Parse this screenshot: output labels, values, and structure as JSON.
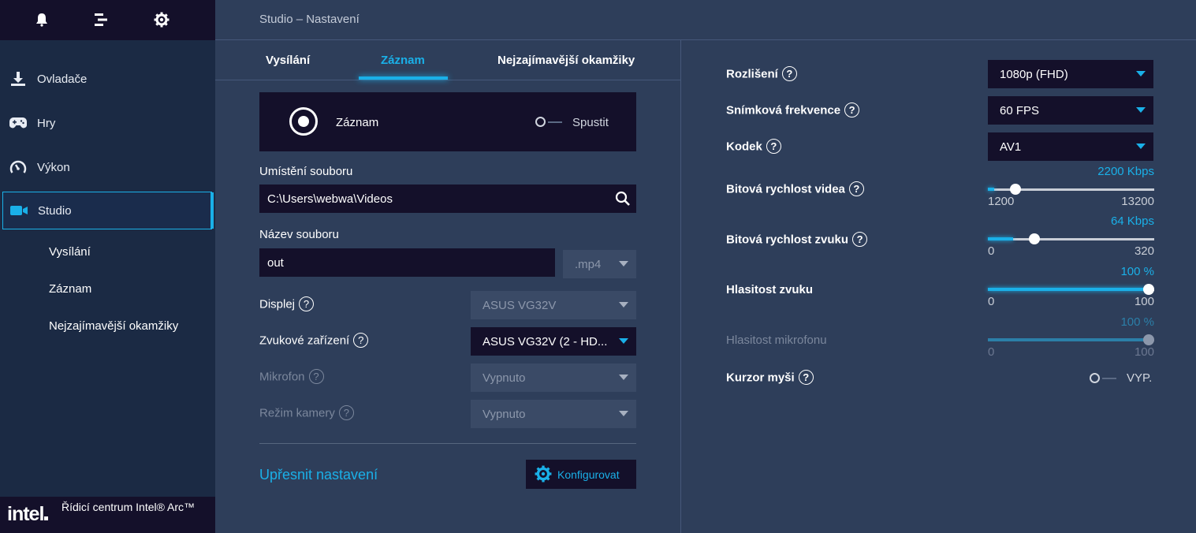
{
  "app": {
    "breadcrumb": "Studio – Nastavení",
    "footer_brand": "intel",
    "footer_title": "Řídicí centrum Intel® Arc™"
  },
  "sidebar": {
    "top_icons": [
      "bell-icon",
      "tasks-icon",
      "gear-icon"
    ],
    "items": [
      {
        "label": "Ovladače",
        "icon": "download-icon"
      },
      {
        "label": "Hry",
        "icon": "gamepad-icon"
      },
      {
        "label": "Výkon",
        "icon": "speedometer-icon"
      },
      {
        "label": "Studio",
        "icon": "camera-icon"
      }
    ],
    "sub_items": [
      "Vysílání",
      "Záznam",
      "Nejzajímavější okamžiky"
    ]
  },
  "tabs": [
    {
      "label": "Vysílání"
    },
    {
      "label": "Záznam"
    },
    {
      "label": "Nejzajímavější okamžiky"
    }
  ],
  "record": {
    "label": "Záznam",
    "toggle_label": "Spustit",
    "toggle_on": false
  },
  "form": {
    "location_label": "Umístění souboru",
    "location_value": "C:\\Users\\webwa\\Videos",
    "filename_label": "Název souboru",
    "filename_value": "out",
    "extension": ".mp4",
    "display_label": "Displej",
    "display_value": "ASUS VG32V",
    "audio_device_label": "Zvukové zařízení",
    "audio_device_value": "ASUS VG32V (2 - HD...",
    "mic_label": "Mikrofon",
    "mic_value": "Vypnuto",
    "camera_label": "Režim kamery",
    "camera_value": "Vypnuto",
    "advanced_link": "Upřesnit nastavení",
    "configure_button": "Konfigurovat",
    "help_glyph": "?"
  },
  "right": {
    "resolution_label": "Rozlišení",
    "resolution_value": "1080p (FHD)",
    "fps_label": "Snímková frekvence",
    "fps_value": "60 FPS",
    "codec_label": "Kodek",
    "codec_value": "AV1",
    "video_bitrate": {
      "label": "Bitová rychlost videa",
      "value_text": "2200 Kbps",
      "min": "1200",
      "max": "13200",
      "fraction": 0.083
    },
    "audio_bitrate": {
      "label": "Bitová rychlost zvuku",
      "value_text": "64 Kbps",
      "min": "0",
      "max": "320",
      "fraction": 0.2
    },
    "audio_volume": {
      "label": "Hlasitost zvuku",
      "value_text": "100 %",
      "min": "0",
      "max": "100",
      "fraction": 1.0
    },
    "mic_volume": {
      "label": "Hlasitost mikrofonu",
      "value_text": "100 %",
      "min": "0",
      "max": "100",
      "fraction": 1.0
    },
    "cursor_label": "Kurzor myši",
    "cursor_toggle_label": "VYP."
  },
  "colors": {
    "accent": "#1ab0e8",
    "panel": "#2e3e5a",
    "dark": "#14102a",
    "sidebar": "#1b2a44"
  }
}
